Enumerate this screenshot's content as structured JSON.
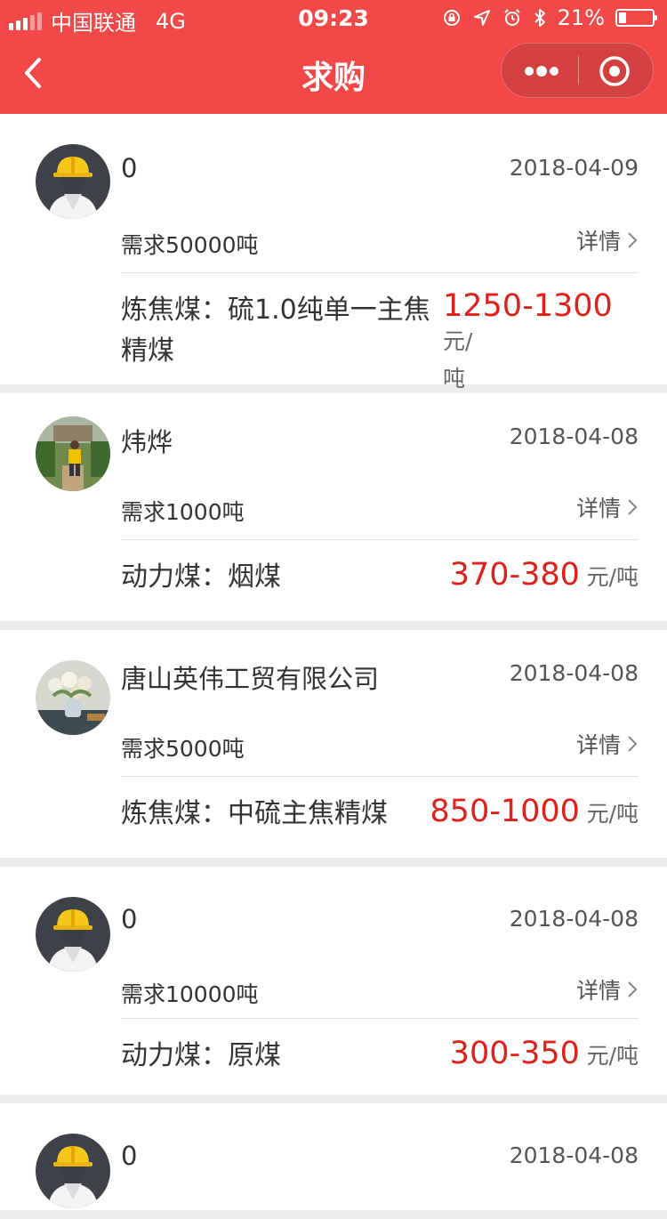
{
  "status_bar": {
    "carrier": "中国联通",
    "network": "4G",
    "time": "09:23",
    "battery": "21%",
    "battery_level": 0.21
  },
  "nav": {
    "title": "求购"
  },
  "colors": {
    "brand_red": "#f24848",
    "price_red": "#e0201a"
  },
  "listings": [
    {
      "name": "0",
      "date": "2018-04-09",
      "demand": "需求50000吨",
      "detail_label": "详情",
      "product_line1": "炼焦煤：硫1.0纯单一主焦",
      "product_line2": "精煤",
      "price": "1250-1300",
      "unit_line1": "元/",
      "unit_line2": "吨",
      "avatar": "helmet-avatar"
    },
    {
      "name": "炜烨",
      "date": "2018-04-08",
      "demand": "需求1000吨",
      "detail_label": "详情",
      "product_line1": "动力煤：烟煤",
      "price": "370-380",
      "unit_line1": "元/吨",
      "avatar": "photo-avatar-person"
    },
    {
      "name": "唐山英伟工贸有限公司",
      "date": "2018-04-08",
      "demand": "需求5000吨",
      "detail_label": "详情",
      "product_line1": "炼焦煤：中硫主焦精煤",
      "price": "850-1000",
      "unit_line1": "元/吨",
      "avatar": "photo-avatar-flowers"
    },
    {
      "name": "0",
      "date": "2018-04-08",
      "demand": "需求10000吨",
      "detail_label": "详情",
      "product_line1": "动力煤：原煤",
      "price": "300-350",
      "unit_line1": "元/吨",
      "avatar": "helmet-avatar"
    },
    {
      "name": "0",
      "date": "2018-04-08",
      "avatar": "helmet-avatar"
    }
  ]
}
